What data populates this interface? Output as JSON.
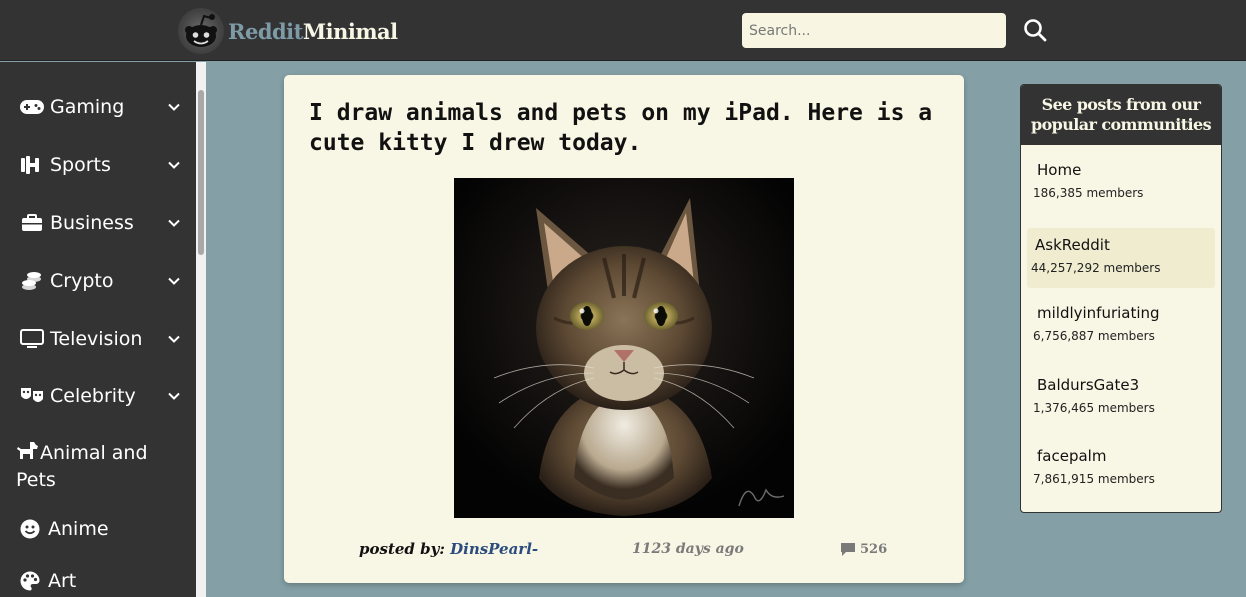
{
  "header": {
    "logo_part1": "Reddit",
    "logo_part2": "Minimal",
    "search_placeholder": "Search..."
  },
  "sidebar": {
    "items": [
      {
        "label": "Gaming",
        "icon": "gamepad-icon",
        "has_chevron": true
      },
      {
        "label": "Sports",
        "icon": "dumbbell-icon",
        "has_chevron": true
      },
      {
        "label": "Business",
        "icon": "briefcase-icon",
        "has_chevron": true
      },
      {
        "label": "Crypto",
        "icon": "coins-icon",
        "has_chevron": true
      },
      {
        "label": "Television",
        "icon": "tv-icon",
        "has_chevron": true
      },
      {
        "label": "Celebrity",
        "icon": "masks-icon",
        "has_chevron": true
      },
      {
        "label": "Animal and Pets",
        "icon": "dog-icon",
        "has_chevron": false
      },
      {
        "label": "Anime",
        "icon": "smiley-icon",
        "has_chevron": false
      },
      {
        "label": "Art",
        "icon": "palette-icon",
        "has_chevron": false
      }
    ]
  },
  "post": {
    "title": "I draw animals and pets on my iPad. Here is a cute kitty I drew today.",
    "posted_by_label": "posted by:",
    "author": "DinsPearl-",
    "age": "1123 days ago",
    "comment_count": "526"
  },
  "communities": {
    "heading": "See posts from our popular communities",
    "items": [
      {
        "name": "Home",
        "members": "186,385 members"
      },
      {
        "name": "AskReddit",
        "members": "44,257,292 members"
      },
      {
        "name": "mildlyinfuriating",
        "members": "6,756,887 members"
      },
      {
        "name": "BaldursGate3",
        "members": "1,376,465 members"
      },
      {
        "name": "facepalm",
        "members": "7,861,915 members"
      }
    ]
  },
  "colors": {
    "background": "#84a0a6",
    "dark": "#333333",
    "card": "#f8f6e4",
    "author_link": "#2b4c7e"
  }
}
